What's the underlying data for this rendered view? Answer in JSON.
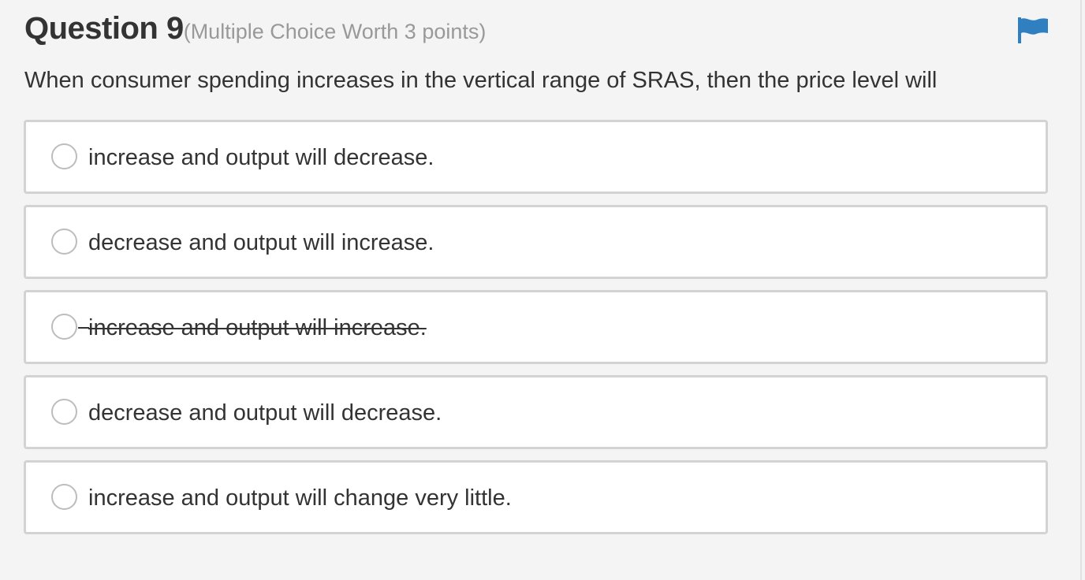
{
  "question": {
    "title": "Question 9",
    "meta": "(Multiple Choice Worth 3 points)",
    "prompt": "When consumer spending increases in the vertical range of SRAS, then the price level will"
  },
  "flag": {
    "icon": "flag-icon",
    "color": "#2f7fc1"
  },
  "choices": [
    {
      "label": "increase and output will decrease.",
      "struck": false,
      "selected": false
    },
    {
      "label": "decrease and output will increase.",
      "struck": false,
      "selected": false
    },
    {
      "label": "increase and output will increase.",
      "struck": true,
      "selected": false
    },
    {
      "label": "decrease and output will decrease.",
      "struck": false,
      "selected": false
    },
    {
      "label": "increase and output will change very little.",
      "struck": false,
      "selected": false
    }
  ]
}
